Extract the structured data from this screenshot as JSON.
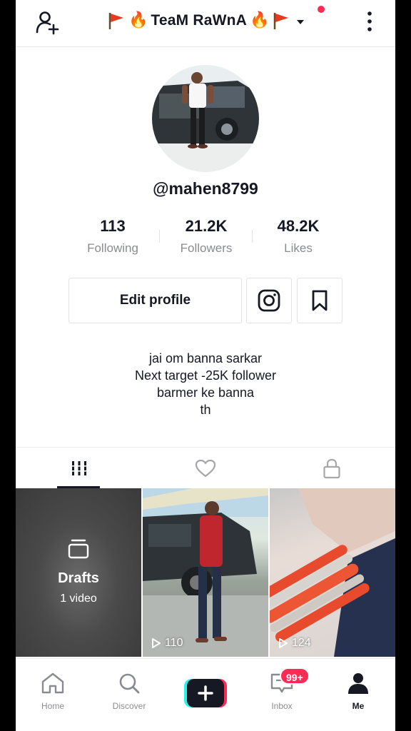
{
  "header": {
    "title": "TeaM RaWnA",
    "add_user_icon": "add-user-icon",
    "more_icon": "more-vertical-icon",
    "accent_red": "#fe2c55"
  },
  "profile": {
    "username": "@mahen8799",
    "stats": [
      {
        "value": "113",
        "label": "Following"
      },
      {
        "value": "21.2K",
        "label": "Followers"
      },
      {
        "value": "48.2K",
        "label": "Likes"
      }
    ],
    "edit_label": "Edit profile",
    "instagram_icon": "instagram-icon",
    "bookmark_icon": "bookmark-icon",
    "bio": [
      "jai om banna sarkar",
      "Next target -25K follower",
      "barmer ke banna",
      "th"
    ]
  },
  "tabs": [
    {
      "icon": "grid-icon",
      "active": true
    },
    {
      "icon": "heart-icon",
      "active": false
    },
    {
      "icon": "lock-icon",
      "active": false
    }
  ],
  "grid": {
    "drafts": {
      "title": "Drafts",
      "subtitle": "1 video"
    },
    "videos": [
      {
        "views": "110"
      },
      {
        "views": "124"
      }
    ]
  },
  "bottom_nav": {
    "items": [
      {
        "label": "Home",
        "icon": "home-icon"
      },
      {
        "label": "Discover",
        "icon": "search-icon"
      },
      {
        "label": "Inbox",
        "icon": "inbox-icon",
        "badge": "99+"
      },
      {
        "label": "Me",
        "icon": "profile-icon"
      }
    ]
  }
}
